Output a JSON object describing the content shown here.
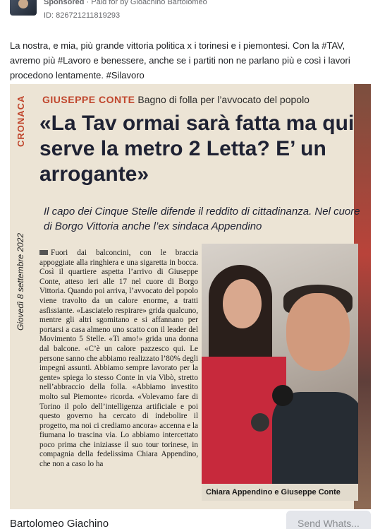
{
  "ad": {
    "sponsored_label": "Sponsored",
    "paid_for": "· Paid for by Gioachino Bartolomeo",
    "library_id": "ID: 826721211819293",
    "more_icon": "more-horizontal-icon"
  },
  "post": {
    "text": "La nostra, e mia, più grande vittoria politica x i torinesi e i piemontesi. Con la #TAV, avremo più #Lavoro e benessere, anche se i partiti non ne parlano più e così i lavori procedono lentamente. #Silavoro"
  },
  "clipping": {
    "section": "CRONACA",
    "date": "Giovedì 8 settembre 2022",
    "kicker_name": "GIUSEPPE CONTE",
    "kicker_text": "Bagno di folla per l’avvocato del popolo",
    "headline": "«La Tav ormai sarà fatta ma qui serve la metro 2 Letta? E’ un arrogante»",
    "subhead": "Il capo dei Cinque Stelle difende il reddito di cittadinanza. Nel cuore di Borgo Vittoria anche l’ex sindaca Appendino",
    "article": "Fuori dai balconcini, con le braccia appoggiate alla ringhiera e una sigaretta in bocca. Così il quartiere aspetta l’arrivo di Giuseppe Conte, atteso ieri alle 17 nel cuore di Borgo Vittoria. Quando poi arriva, l’avvocato del popolo viene travolto da un calore enorme, a tratti asfissiante. «Lasciatelo respirare» grida qualcuno, mentre gli altri sgomitano e si affannano per portarsi a casa almeno uno scatto con il leader del Movimento 5 Stelle. «Ti amo!» grida una donna dal balcone. «C’è un calore pazzesco qui. Le persone sanno che abbiamo realizzato l’80% degli impegni assunti. Abbiamo sempre lavorato per la gente» spiega lo stesso Conte in via Vibò, stretto nell’abbraccio della folla. «Abbiamo investito molto sul Piemonte» ricorda. «Volevamo fare di Torino il polo dell’intelligenza artificiale e poi questo governo ha cercato di indebolire il progetto, ma noi ci crediamo ancora» accenna e la fiumana lo trascina via. Lo abbiamo intercettato poco prima che iniziasse il suo tour torinese, in compagnia della fedelissima Chiara Appendino, che non a caso lo ha",
    "photo_caption": "Chiara Appendino e Giuseppe Conte"
  },
  "footer": {
    "page_name": "Bartolomeo Giachino",
    "cta_label": "Send Whats..."
  },
  "colors": {
    "accent_red": "#c0462d",
    "headline_navy": "#1f2233",
    "button_gray": "#e4e6eb"
  }
}
